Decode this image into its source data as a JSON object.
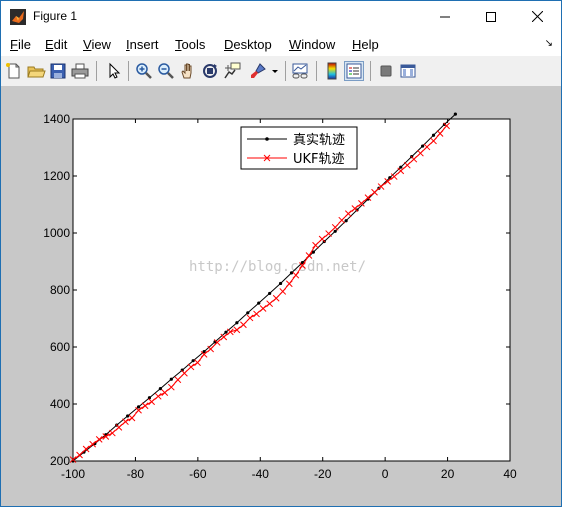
{
  "window": {
    "title": "Figure 1",
    "min_glyph": "—",
    "max_glyph": "☐",
    "close_glyph": "✕"
  },
  "menubar": [
    {
      "acc": "F",
      "rest": "ile"
    },
    {
      "acc": "E",
      "rest": "dit"
    },
    {
      "acc": "V",
      "rest": "iew"
    },
    {
      "acc": "I",
      "rest": "nsert"
    },
    {
      "acc": "T",
      "rest": "ools"
    },
    {
      "acc": "D",
      "rest": "esktop"
    },
    {
      "acc": "W",
      "rest": "indow"
    },
    {
      "acc": "H",
      "rest": "elp"
    }
  ],
  "dock_arrow": "↘",
  "toolbar": [
    "new-figure-icon",
    "open-file-icon",
    "save-icon",
    "print-icon",
    "pointer-icon",
    "zoom-in-icon",
    "zoom-out-icon",
    "pan-hand-icon",
    "rotate-3d-icon",
    "data-cursor-icon",
    "brush-icon",
    "link-plot-icon",
    "colorbar-icon",
    "legend-icon",
    "hide-plot-tools-icon",
    "show-plot-tools-icon"
  ],
  "watermark": "http://blog.csdn.net/",
  "chart_data": {
    "type": "line",
    "title": "",
    "xlabel": "",
    "ylabel": "",
    "xlim": [
      -100,
      40
    ],
    "ylim": [
      200,
      1400
    ],
    "xticks": [
      -100,
      -80,
      -60,
      -40,
      -20,
      0,
      20,
      40
    ],
    "yticks": [
      200,
      400,
      600,
      800,
      1000,
      1200,
      1400
    ],
    "legend_position": "top-center",
    "series": [
      {
        "name": "真实轨迹",
        "color": "#000000",
        "marker": "dot",
        "x": [
          -100,
          -96.5,
          -93,
          -89.5,
          -86,
          -82.5,
          -79,
          -75.5,
          -72,
          -68.5,
          -65,
          -61.5,
          -58,
          -54.5,
          -51,
          -47.5,
          -44,
          -40.5,
          -37,
          -33.5,
          -30,
          -26.5,
          -23,
          -19.5,
          -16,
          -12.5,
          -9,
          -5.5,
          -2,
          1.5,
          5,
          8.5,
          12,
          15.5,
          19,
          22.5
        ],
        "y": [
          200,
          231,
          261,
          292,
          326,
          358,
          390,
          422,
          454,
          487,
          519,
          552,
          584,
          618,
          652,
          685,
          720,
          754,
          788,
          823,
          860,
          896,
          933,
          970,
          1006,
          1043,
          1081,
          1119,
          1157,
          1194,
          1231,
          1268,
          1305,
          1343,
          1381,
          1417
        ]
      },
      {
        "name": "UKF轨迹",
        "color": "#ff0000",
        "marker": "cross",
        "x": [
          -100,
          -97.9,
          -95.8,
          -93.7,
          -91.6,
          -89.5,
          -87.4,
          -85.3,
          -83.2,
          -81.1,
          -79,
          -76.9,
          -74.8,
          -72.7,
          -70.6,
          -68.5,
          -66.4,
          -64.3,
          -62.2,
          -60.1,
          -58,
          -55.9,
          -53.8,
          -51.7,
          -49.6,
          -47.5,
          -45.4,
          -43.3,
          -41.2,
          -39.1,
          -37,
          -34.9,
          -32.8,
          -30.7,
          -28.6,
          -26.5,
          -24.4,
          -22.3,
          -20.2,
          -18.1,
          -16,
          -13.9,
          -11.8,
          -9.7,
          -7.6,
          -5.5,
          -3.4,
          -1.3,
          0.8,
          2.9,
          5,
          7.1,
          9.2,
          11.3,
          13.4,
          15.5,
          17.6,
          19.7
        ],
        "y": [
          205,
          221,
          242,
          259,
          276,
          286,
          298,
          318,
          338,
          351,
          378,
          394,
          408,
          427,
          440,
          459,
          485,
          508,
          530,
          545,
          574,
          593,
          616,
          635,
          653,
          660,
          678,
          702,
          716,
          735,
          752,
          771,
          795,
          822,
          852,
          886,
          921,
          957,
          979,
          998,
          1020,
          1045,
          1068,
          1086,
          1104,
          1124,
          1143,
          1163,
          1181,
          1198,
          1218,
          1238,
          1259,
          1280,
          1302,
          1323,
          1349,
          1376
        ]
      }
    ]
  }
}
